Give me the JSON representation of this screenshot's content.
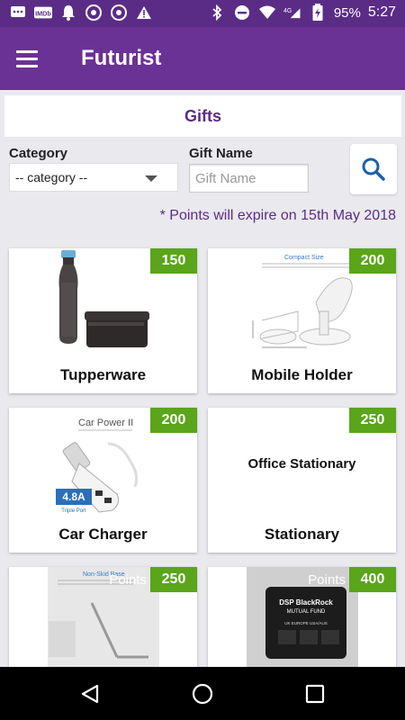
{
  "status_bar": {
    "battery": "95%",
    "time": "5:27",
    "network": "4G"
  },
  "app": {
    "title": "Futurist"
  },
  "section": {
    "title": "Gifts"
  },
  "filters": {
    "category_label": "Category",
    "category_value": "-- category --",
    "gift_name_label": "Gift Name",
    "gift_name_placeholder": "Gift Name"
  },
  "notice": "* Points will expire on 15th May 2018",
  "gifts": [
    {
      "name": "Tupperware",
      "points": "150",
      "image": "tupperware-bottle-container"
    },
    {
      "name": "Mobile Holder",
      "points": "200",
      "image_text": "Compact Size",
      "image": "mobile-holder"
    },
    {
      "name": "Car Charger",
      "points": "200",
      "image_text": "Car Power II",
      "badge_text": "4.8A",
      "badge_sub": "Triple Port",
      "image": "car-charger"
    },
    {
      "name": "Stationary",
      "points": "250",
      "image_text": "Office Stationary",
      "image": "office-stationary"
    },
    {
      "name": "",
      "points": "250",
      "points_label": "Points",
      "image_text": "Non-Skid Base",
      "image": "phone-stand"
    },
    {
      "name": "",
      "points": "400",
      "points_label": "Points",
      "image_text_1": "DSP BlackRock",
      "image_text_2": "MUTUAL FUND",
      "image_text_3": "UK   EUROPE   USA/AUS",
      "image": "travel-adapter"
    }
  ],
  "colors": {
    "primary": "#6a3295",
    "status": "#5b2c86",
    "badge": "#5aa51a",
    "accent": "#5b2c86"
  }
}
